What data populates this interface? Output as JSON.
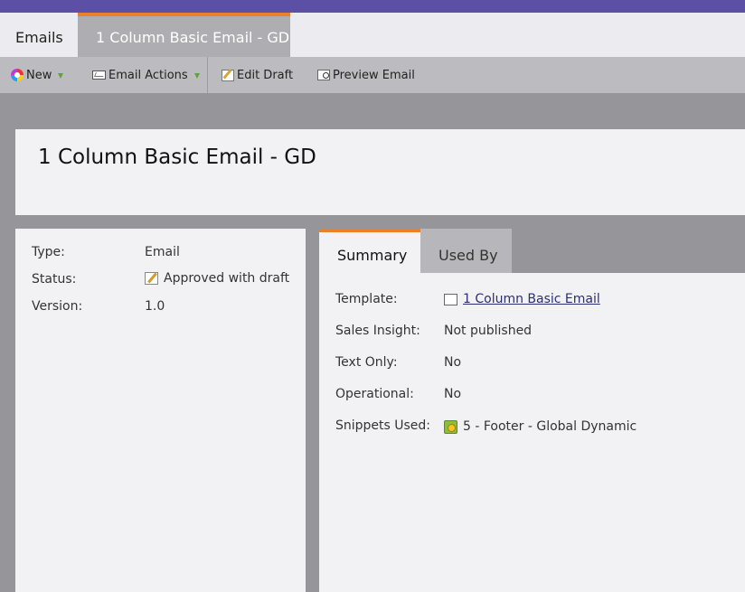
{
  "tabs": {
    "emails": "Emails",
    "current": "1 Column Basic Email - GD"
  },
  "toolbar": {
    "new_label": "New",
    "new_icon": "new-icon",
    "email_actions_label": "Email Actions",
    "email_actions_icon": "envelope-icon",
    "edit_draft_label": "Edit Draft",
    "edit_draft_icon": "edit-draft-icon",
    "preview_label": "Preview Email",
    "preview_icon": "preview-icon"
  },
  "page_title": "1 Column Basic Email - GD",
  "details": {
    "type_label": "Type:",
    "type_value": "Email",
    "status_label": "Status:",
    "status_value": "Approved with draft",
    "status_icon": "draft-icon",
    "version_label": "Version:",
    "version_value": "1.0"
  },
  "summary_tabs": {
    "summary": "Summary",
    "used_by": "Used By"
  },
  "summary": {
    "template_label": "Template:",
    "template_value": "1 Column Basic Email",
    "sales_insight_label": "Sales Insight:",
    "sales_insight_value": "Not published",
    "text_only_label": "Text Only:",
    "text_only_value": "No",
    "operational_label": "Operational:",
    "operational_value": "No",
    "snippets_label": "Snippets Used:",
    "snippets_value": "5 - Footer - Global Dynamic"
  },
  "colors": {
    "top_bar": "#5b50a5",
    "accent": "#e8812c",
    "link": "#2a2f73"
  }
}
